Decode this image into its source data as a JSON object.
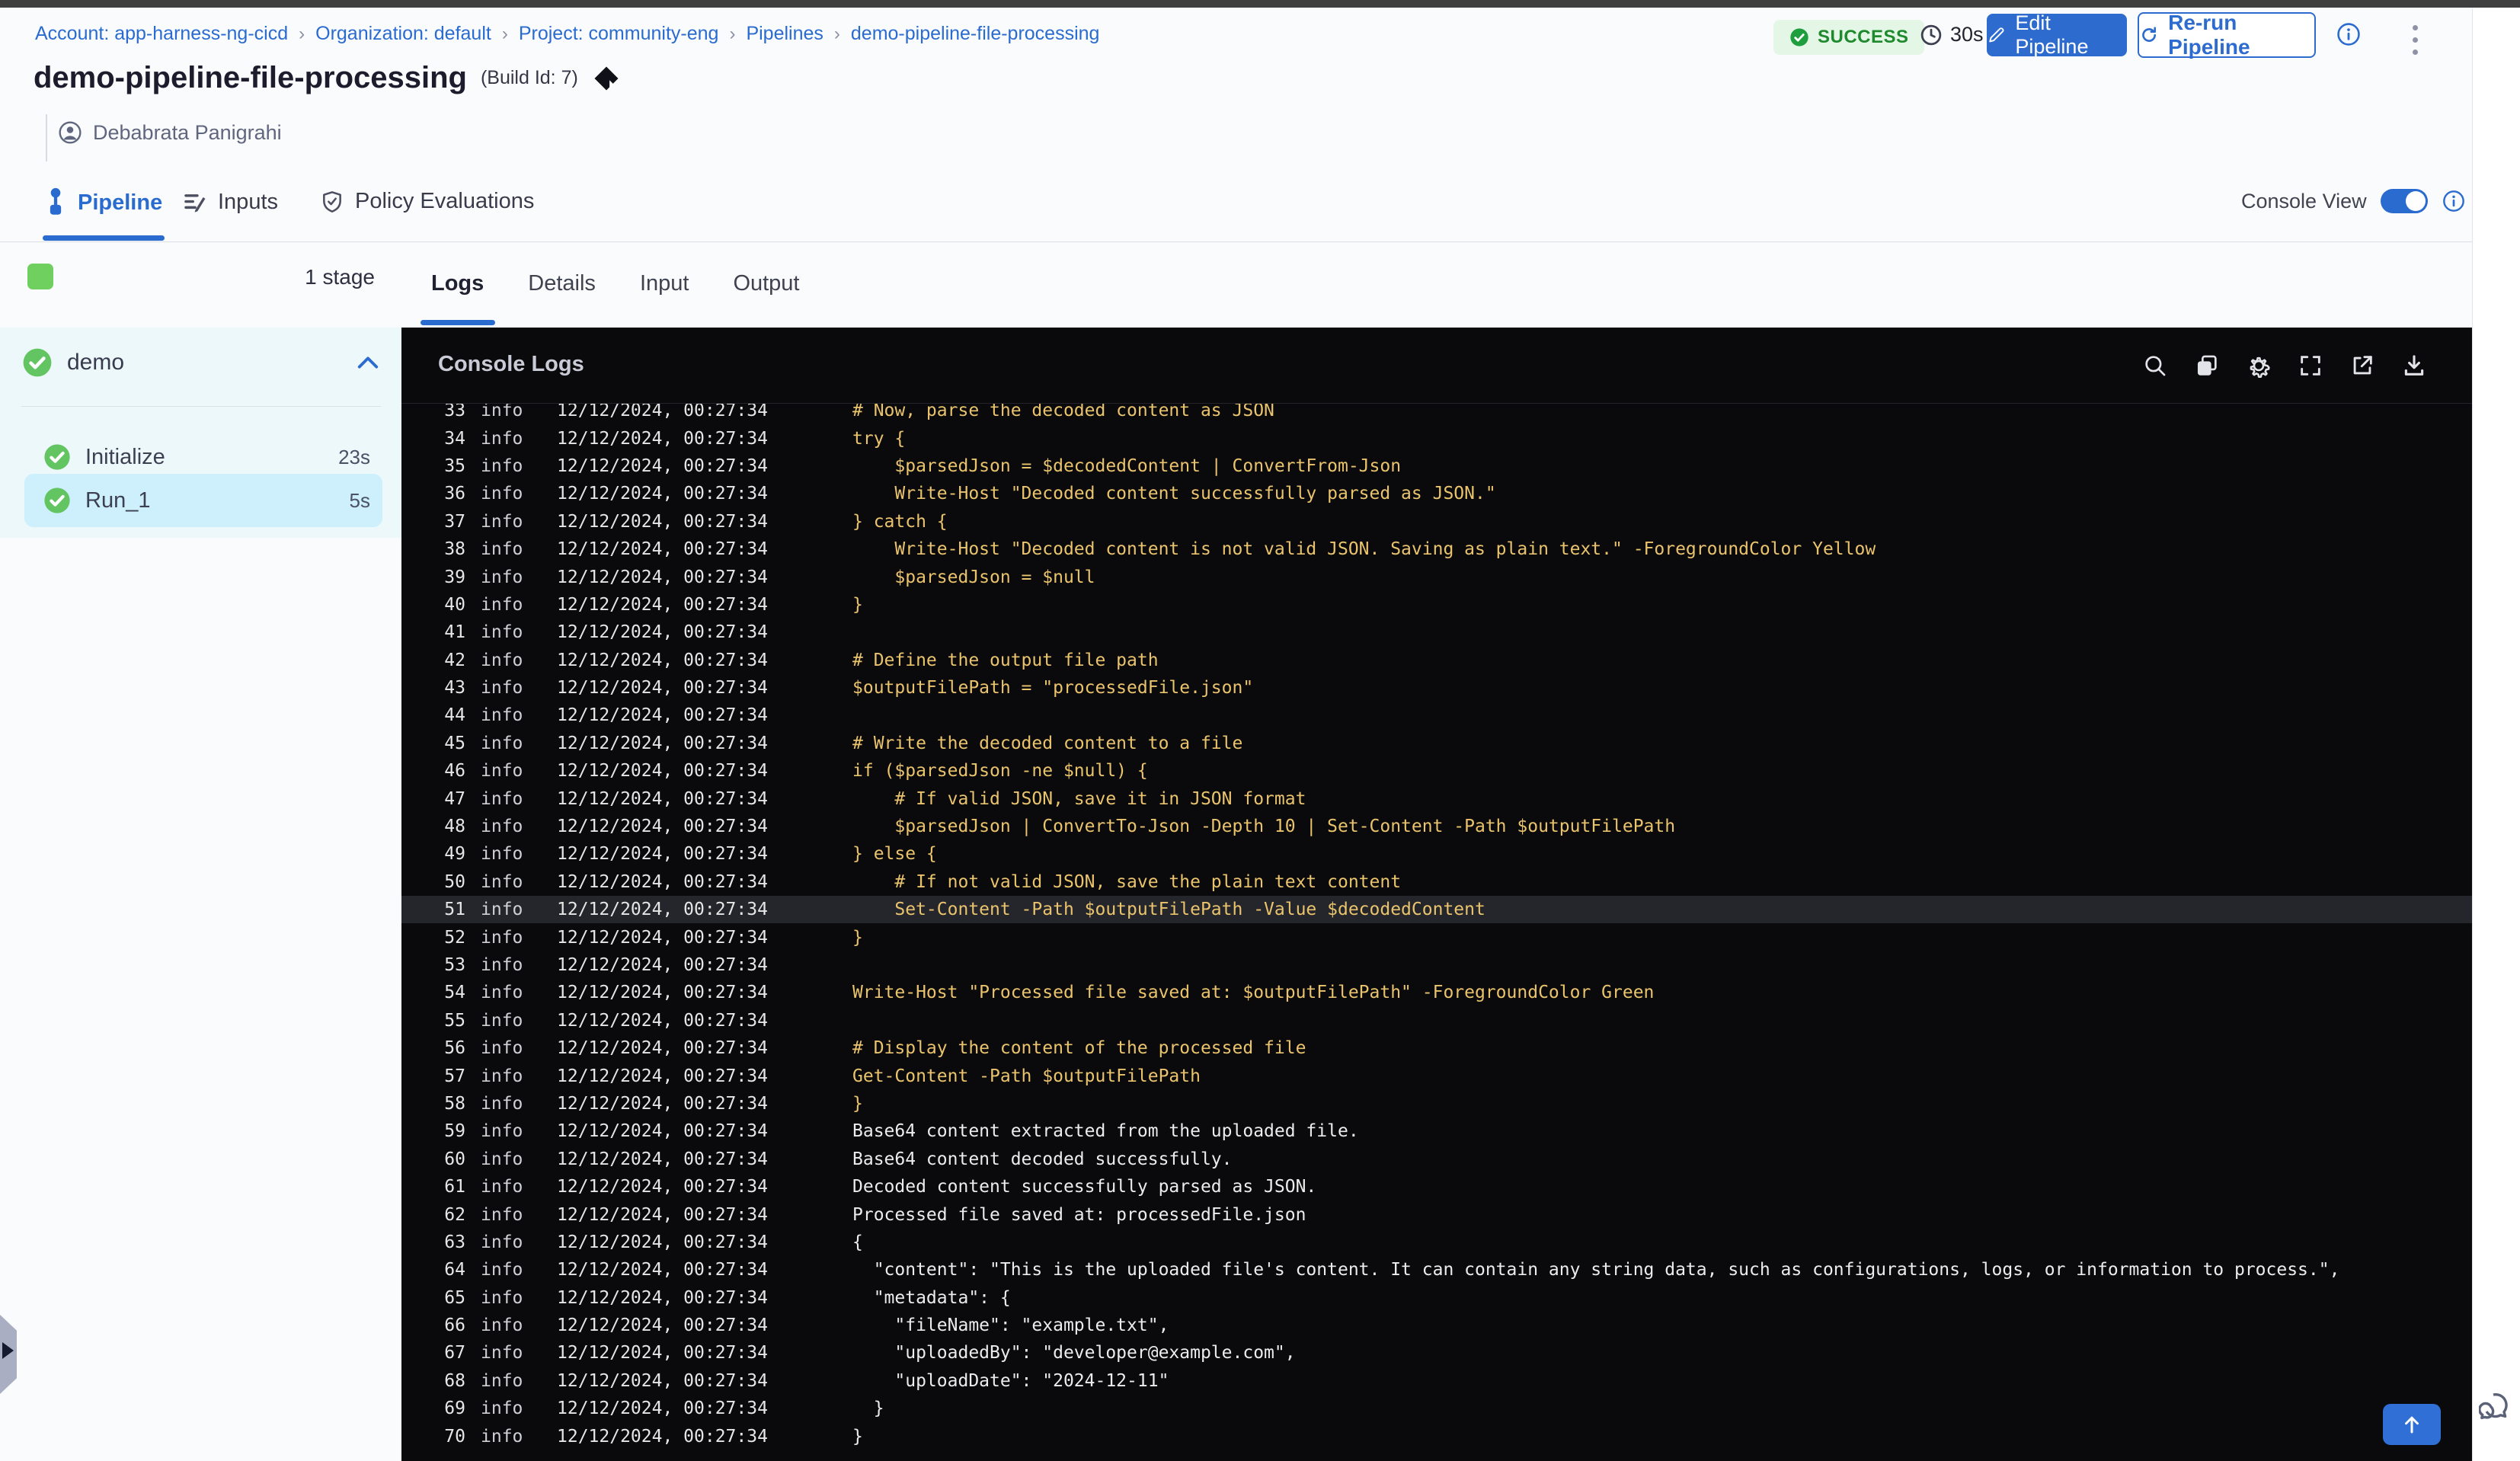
{
  "breadcrumb": {
    "separator": "›",
    "items": [
      "Account: app-harness-ng-cicd",
      "Organization: default",
      "Project: community-eng",
      "Pipelines",
      "demo-pipeline-file-processing"
    ]
  },
  "header": {
    "title": "demo-pipeline-file-processing",
    "build_id": "(Build Id: 7)",
    "user": "Debabrata Panigrahi",
    "status": "SUCCESS",
    "duration": "30s",
    "edit_button": "Edit Pipeline",
    "rerun_button": "Re-run Pipeline"
  },
  "tabs": {
    "pipeline": "Pipeline",
    "inputs": "Inputs",
    "policy": "Policy Evaluations",
    "console_view_label": "Console View"
  },
  "stage_panel": {
    "stage_count": "1 stage",
    "stage_name": "demo",
    "steps": [
      {
        "name": "Initialize",
        "duration": "23s",
        "selected": false
      },
      {
        "name": "Run_1",
        "duration": "5s",
        "selected": true
      }
    ]
  },
  "console": {
    "tabs": [
      "Logs",
      "Details",
      "Input",
      "Output"
    ],
    "active_tab": "Logs",
    "title": "Console Logs",
    "icon_names": [
      "search-icon",
      "copy-icon",
      "settings-icon",
      "fullscreen-icon",
      "open-in-new-icon",
      "download-icon"
    ],
    "log_time": "12/12/2024, 00:27:34",
    "colors": {
      "script_text": "#eac36d",
      "output_text": "#ececec",
      "highlight_row_bg": "#24262c",
      "panel_bg": "#0a0a0c"
    },
    "lines": [
      {
        "n": 33,
        "level": "info",
        "type": "script",
        "text": "# Now, parse the decoded content as JSON"
      },
      {
        "n": 34,
        "level": "info",
        "type": "script",
        "text": "try {"
      },
      {
        "n": 35,
        "level": "info",
        "type": "script",
        "text": "    $parsedJson = $decodedContent | ConvertFrom-Json"
      },
      {
        "n": 36,
        "level": "info",
        "type": "script",
        "text": "    Write-Host \"Decoded content successfully parsed as JSON.\""
      },
      {
        "n": 37,
        "level": "info",
        "type": "script",
        "text": "} catch {"
      },
      {
        "n": 38,
        "level": "info",
        "type": "script",
        "text": "    Write-Host \"Decoded content is not valid JSON. Saving as plain text.\" -ForegroundColor Yellow"
      },
      {
        "n": 39,
        "level": "info",
        "type": "script",
        "text": "    $parsedJson = $null"
      },
      {
        "n": 40,
        "level": "info",
        "type": "script",
        "text": "}"
      },
      {
        "n": 41,
        "level": "info",
        "type": "script",
        "text": ""
      },
      {
        "n": 42,
        "level": "info",
        "type": "script",
        "text": "# Define the output file path"
      },
      {
        "n": 43,
        "level": "info",
        "type": "script",
        "text": "$outputFilePath = \"processedFile.json\""
      },
      {
        "n": 44,
        "level": "info",
        "type": "script",
        "text": ""
      },
      {
        "n": 45,
        "level": "info",
        "type": "script",
        "text": "# Write the decoded content to a file"
      },
      {
        "n": 46,
        "level": "info",
        "type": "script",
        "text": "if ($parsedJson -ne $null) {"
      },
      {
        "n": 47,
        "level": "info",
        "type": "script",
        "text": "    # If valid JSON, save it in JSON format"
      },
      {
        "n": 48,
        "level": "info",
        "type": "script",
        "text": "    $parsedJson | ConvertTo-Json -Depth 10 | Set-Content -Path $outputFilePath"
      },
      {
        "n": 49,
        "level": "info",
        "type": "script",
        "text": "} else {"
      },
      {
        "n": 50,
        "level": "info",
        "type": "script",
        "text": "    # If not valid JSON, save the plain text content"
      },
      {
        "n": 51,
        "level": "info",
        "type": "script",
        "text": "    Set-Content -Path $outputFilePath -Value $decodedContent",
        "highlight": true
      },
      {
        "n": 52,
        "level": "info",
        "type": "script",
        "text": "}"
      },
      {
        "n": 53,
        "level": "info",
        "type": "script",
        "text": ""
      },
      {
        "n": 54,
        "level": "info",
        "type": "script",
        "text": "Write-Host \"Processed file saved at: $outputFilePath\" -ForegroundColor Green"
      },
      {
        "n": 55,
        "level": "info",
        "type": "script",
        "text": ""
      },
      {
        "n": 56,
        "level": "info",
        "type": "script",
        "text": "# Display the content of the processed file"
      },
      {
        "n": 57,
        "level": "info",
        "type": "script",
        "text": "Get-Content -Path $outputFilePath"
      },
      {
        "n": 58,
        "level": "info",
        "type": "script",
        "text": "}"
      },
      {
        "n": 59,
        "level": "info",
        "type": "output",
        "text": "Base64 content extracted from the uploaded file."
      },
      {
        "n": 60,
        "level": "info",
        "type": "output",
        "text": "Base64 content decoded successfully."
      },
      {
        "n": 61,
        "level": "info",
        "type": "output",
        "text": "Decoded content successfully parsed as JSON."
      },
      {
        "n": 62,
        "level": "info",
        "type": "output",
        "text": "Processed file saved at: processedFile.json"
      },
      {
        "n": 63,
        "level": "info",
        "type": "output",
        "text": "{"
      },
      {
        "n": 64,
        "level": "info",
        "type": "output",
        "text": "  \"content\": \"This is the uploaded file's content. It can contain any string data, such as configurations, logs, or information to process.\","
      },
      {
        "n": 65,
        "level": "info",
        "type": "output",
        "text": "  \"metadata\": {"
      },
      {
        "n": 66,
        "level": "info",
        "type": "output",
        "text": "    \"fileName\": \"example.txt\","
      },
      {
        "n": 67,
        "level": "info",
        "type": "output",
        "text": "    \"uploadedBy\": \"developer@example.com\","
      },
      {
        "n": 68,
        "level": "info",
        "type": "output",
        "text": "    \"uploadDate\": \"2024-12-11\""
      },
      {
        "n": 69,
        "level": "info",
        "type": "output",
        "text": "  }"
      },
      {
        "n": 70,
        "level": "info",
        "type": "output",
        "text": "}"
      }
    ]
  }
}
